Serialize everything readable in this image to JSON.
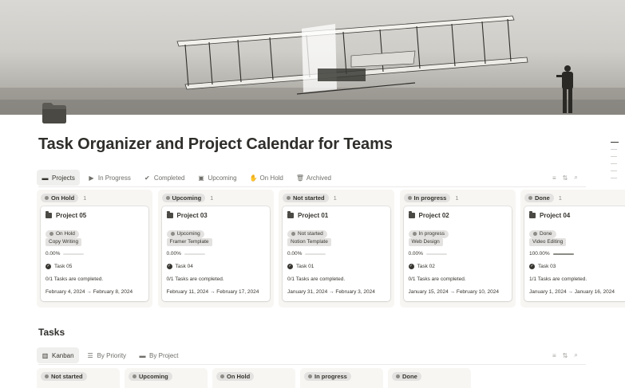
{
  "page": {
    "title": "Task Organizer and Project Calendar for Teams",
    "icon": "folder-icon"
  },
  "projects_view": {
    "tabs": [
      {
        "label": "Projects",
        "icon": "folder-icon",
        "active": true
      },
      {
        "label": "In Progress",
        "icon": "play-icon",
        "active": false
      },
      {
        "label": "Completed",
        "icon": "check-circle-icon",
        "active": false
      },
      {
        "label": "Upcoming",
        "icon": "calendar-icon",
        "active": false
      },
      {
        "label": "On Hold",
        "icon": "hand-icon",
        "active": false
      },
      {
        "label": "Archived",
        "icon": "trash-icon",
        "active": false
      }
    ],
    "toolbar_icons": [
      "filter-icon",
      "sort-icon",
      "search-icon"
    ],
    "columns": [
      {
        "status": "On Hold",
        "count": "1",
        "card": {
          "title": "Project 05",
          "status": "On Hold",
          "tag": "Copy Writing",
          "progress_text": "0.00%",
          "progress": 0,
          "task": "Task 05",
          "tasks_done": "0/1 Tasks are completed.",
          "dates": "February 4, 2024 → February 8, 2024"
        }
      },
      {
        "status": "Upcoming",
        "count": "1",
        "card": {
          "title": "Project 03",
          "status": "Upcoming",
          "tag": "Framer Template",
          "progress_text": "0.00%",
          "progress": 0,
          "task": "Task 04",
          "tasks_done": "0/1 Tasks are completed.",
          "dates": "February 11, 2024 → February 17, 2024"
        }
      },
      {
        "status": "Not started",
        "count": "1",
        "card": {
          "title": "Project 01",
          "status": "Not started",
          "tag": "Notion Template",
          "progress_text": "0.00%",
          "progress": 0,
          "task": "Task 01",
          "tasks_done": "0/1 Tasks are completed.",
          "dates": "January 31, 2024 → February 3, 2024"
        }
      },
      {
        "status": "In progress",
        "count": "1",
        "card": {
          "title": "Project 02",
          "status": "In progress",
          "tag": "Web Design",
          "progress_text": "0.00%",
          "progress": 0,
          "task": "Task 02",
          "tasks_done": "0/1 Tasks are completed.",
          "dates": "January 15, 2024 → February 10, 2024"
        }
      },
      {
        "status": "Done",
        "count": "1",
        "card": {
          "title": "Project 04",
          "status": "Done",
          "tag": "Video Editing",
          "progress_text": "100.00%",
          "progress": 1,
          "task": "Task 03",
          "tasks_done": "1/1 Tasks are completed.",
          "dates": "January 1, 2024 → January 16, 2024"
        }
      }
    ]
  },
  "tasks_section": {
    "title": "Tasks",
    "tabs": [
      {
        "label": "Kanban",
        "icon": "board-icon",
        "active": true
      },
      {
        "label": "By Priority",
        "icon": "list-icon",
        "active": false
      },
      {
        "label": "By Project",
        "icon": "folder-icon",
        "active": false
      }
    ],
    "toolbar_icons": [
      "filter-icon",
      "sort-icon",
      "search-icon"
    ],
    "columns": [
      "Not started",
      "Upcoming",
      "On Hold",
      "In progress",
      "Done"
    ]
  },
  "colors": {
    "tab_active_bg": "#efefed",
    "column_bg": "#f7f6f3",
    "pill_bg": "#e3e2e0",
    "text": "#37352f"
  }
}
